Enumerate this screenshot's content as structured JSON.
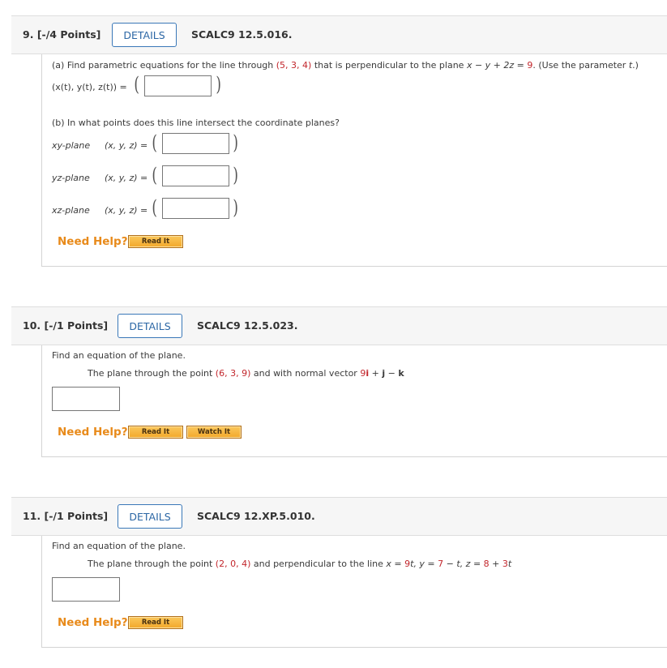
{
  "q9": {
    "number": "9.",
    "points": "[-/4 Points]",
    "details_label": "DETAILS",
    "code": "SCALC9 12.5.016.",
    "part_a": {
      "prefix": "(a) Find parametric equations for the line through ",
      "point": "(5, 3, 4)",
      "mid": " that is perpendicular to the plane ",
      "plane_lhs": "x − y + 2z = ",
      "plane_rhs": "9",
      "suffix_a": ". (Use the parameter ",
      "param": "t",
      "suffix_b": ".)",
      "label": "(x(t), y(t), z(t)) = "
    },
    "part_b": {
      "prompt": "(b) In what points does this line intersect the coordinate planes?",
      "rows": [
        {
          "plane": "xy-plane",
          "label": "(x, y, z) = "
        },
        {
          "plane": "yz-plane",
          "label": "(x, y, z) = "
        },
        {
          "plane": "xz-plane",
          "label": "(x, y, z) = "
        }
      ]
    },
    "need_help": "Need Help?",
    "read_it": "Read It"
  },
  "q10": {
    "number": "10.",
    "points": "[-/1 Points]",
    "details_label": "DETAILS",
    "code": "SCALC9 12.5.023.",
    "instruction": "Find an equation of the plane.",
    "prefix": "The plane through the point ",
    "point": "(6, 3, 9)",
    "mid": " and with normal vector ",
    "vec_coeff": "9",
    "vec_i": "i",
    "vec_plus": " + ",
    "vec_j": "j",
    "vec_minus": " − ",
    "vec_k": "k",
    "need_help": "Need Help?",
    "read_it": "Read It",
    "watch_it": "Watch It"
  },
  "q11": {
    "number": "11.",
    "points": "[-/1 Points]",
    "details_label": "DETAILS",
    "code": "SCALC9 12.XP.5.010.",
    "instruction": "Find an equation of the plane.",
    "prefix": "The plane through the point ",
    "point": "(2, 0, 4)",
    "mid": " and perpendicular to the line ",
    "x_eq": "x = ",
    "x_val": "9",
    "t1": "t",
    "y_eq": ", y = ",
    "y_val": "7",
    "y_minus": " − t",
    "z_eq": ", z = ",
    "z_val_a": "8",
    "z_plus": " + ",
    "z_val_b": "3",
    "t3": "t",
    "need_help": "Need Help?",
    "read_it": "Read It"
  },
  "colors": {
    "highlight_red": "#c2262c",
    "details_blue": "#2c67a5",
    "help_orange": "#e88a1a",
    "button_gold": "#f2a72a"
  }
}
